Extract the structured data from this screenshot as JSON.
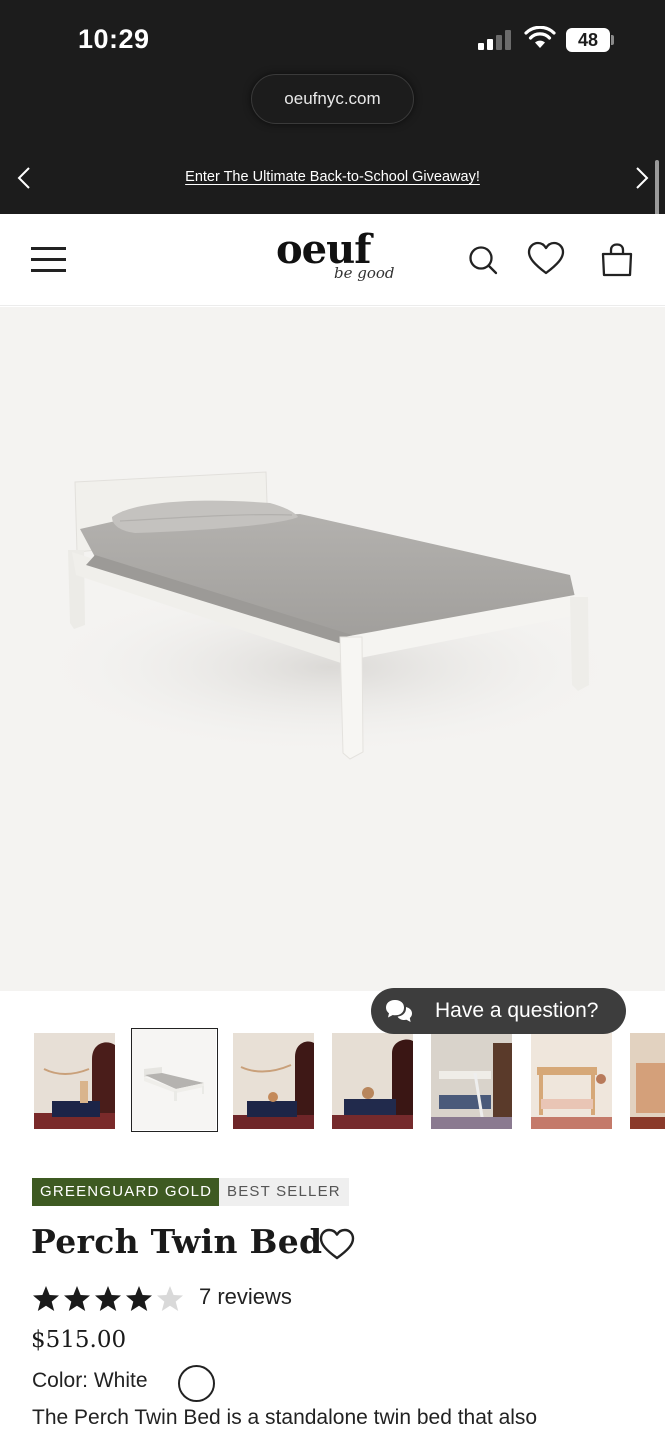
{
  "status_bar": {
    "time": "10:29",
    "battery": "48"
  },
  "browser": {
    "url": "oeufnyc.com"
  },
  "announcement": {
    "text": "Enter The Ultimate Back-to-School Giveaway!"
  },
  "header": {
    "logo_text": "oeuf",
    "logo_tagline": "be good",
    "icons": [
      "menu-icon",
      "search-icon",
      "heart-icon",
      "bag-icon"
    ]
  },
  "gallery": {
    "thumbnail_count": 7,
    "active_index": 1,
    "chat_label": "Have a question?"
  },
  "product": {
    "badges": [
      "GREENGUARD GOLD",
      "BEST SELLER"
    ],
    "title": "Perch Twin Bed",
    "rating": 4.5,
    "reviews_label": "7 reviews",
    "price": "$515.00",
    "color_label": "Color: White",
    "description": "The Perch Twin Bed is a standalone twin bed that also"
  },
  "colors": {
    "top_bar": "#1c1c1c",
    "badge_green": "#3e5a22",
    "hero_bg": "#f4f3f1"
  }
}
